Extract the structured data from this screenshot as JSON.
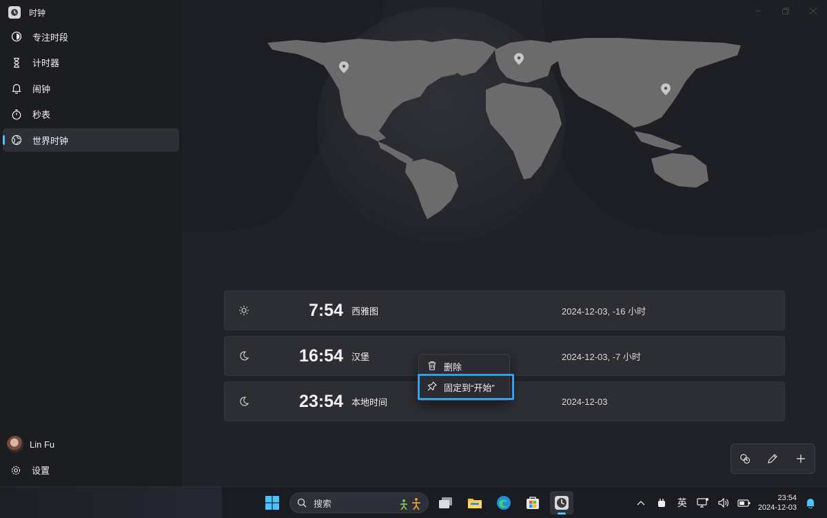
{
  "app": {
    "title": "时钟"
  },
  "sidebar": {
    "items": [
      {
        "label": "专注时段",
        "icon": "focus-icon"
      },
      {
        "label": "计时器",
        "icon": "hourglass-icon"
      },
      {
        "label": "闹钟",
        "icon": "bell-icon"
      },
      {
        "label": "秒表",
        "icon": "stopwatch-icon"
      },
      {
        "label": "世界时钟",
        "icon": "globe-icon",
        "active": true
      }
    ],
    "user_name": "Lin Fu",
    "settings_label": "设置"
  },
  "clocks": [
    {
      "icon": "sun-icon",
      "time": "7:54",
      "city": "西雅图",
      "date": "2024-12-03, -16 小时"
    },
    {
      "icon": "moon-icon",
      "time": "16:54",
      "city": "汉堡",
      "date": "2024-12-03, -7 小时"
    },
    {
      "icon": "moon-icon",
      "time": "23:54",
      "city": "本地时间",
      "date": "2024-12-03"
    }
  ],
  "context_menu": {
    "delete_label": "删除",
    "pin_label": "固定到“开始”"
  },
  "taskbar": {
    "search_placeholder": "搜索",
    "ime": "英",
    "time": "23:54",
    "date": "2024-12-03"
  },
  "colors": {
    "accent": "#4cc2ff",
    "highlight_border": "#2ea1ee",
    "map_land": "#666666",
    "background": "#202228"
  }
}
